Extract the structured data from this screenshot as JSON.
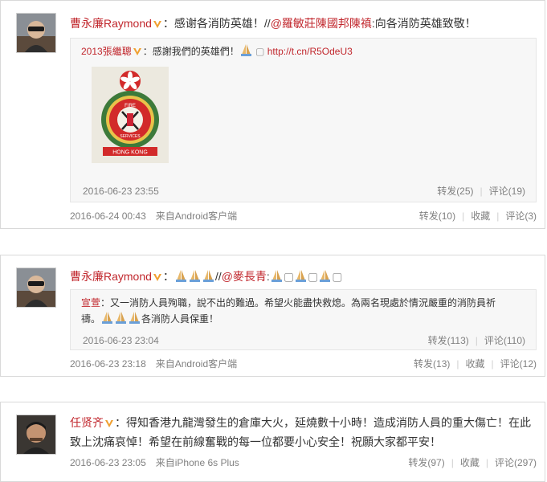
{
  "posts": [
    {
      "username": "曹永廉Raymond",
      "text_a": "感谢各消防英雄！",
      "text_b": "//",
      "mention": "@羅敏莊陳國邦陳禛",
      "text_c": ":向各消防英雄致敬！",
      "repost": {
        "username": "2013張繼聰",
        "text_a": "感謝我們的英雄們！",
        "link": "http://t.cn/R5OdeU3",
        "image_label": "FIRE SERVICES HONG KONG",
        "time": "2016-06-23 23:55",
        "repost_label": "转发(25)",
        "comment_label": "评论(19)"
      },
      "time": "2016-06-24 00:43",
      "source": "来自Android客户端",
      "repost_label": "转发(10)",
      "fav_label": "收藏",
      "comment_label": "评论(3)"
    },
    {
      "username": "曹永廉Raymond",
      "text_b": "//",
      "mention": "@麥長青",
      "colon": ":",
      "repost": {
        "username": "宣萱",
        "text_a": "又一消防人員殉職，說不出的難過。希望火能盡快救熄。為兩名現處於情況嚴重的消防員祈",
        "text_b": "禱。",
        "text_c": "各消防人員保重！",
        "time": "2016-06-23 23:04",
        "repost_label": "转发(113)",
        "comment_label": "评论(110)"
      },
      "time": "2016-06-23 23:18",
      "source": "来自Android客户端",
      "repost_label": "转发(13)",
      "fav_label": "收藏",
      "comment_label": "评论(12)"
    },
    {
      "username": "任贤齐",
      "text_line1": "得知香港九龍灣發生的倉庫大火，延燒數十小時！造成消防人員的重大傷亡！在此",
      "text_line2": "致上沈痛哀悼！希望在前線奮戰的每一位都要小心安全！祝願大家都平安！",
      "time": "2016-06-23 23:05",
      "source": "来自iPhone 6s Plus",
      "repost_label": "转发(97)",
      "fav_label": "收藏",
      "comment_label": "评论(297)"
    }
  ],
  "colors": {
    "name_red": "#c1272d",
    "meta_gray": "#808080",
    "badge_orange": "#f0a030",
    "repost_bg": "#f7f7f7"
  },
  "icons": [
    "verified-v-icon",
    "pray-emoji-icon",
    "avatar-icon"
  ]
}
